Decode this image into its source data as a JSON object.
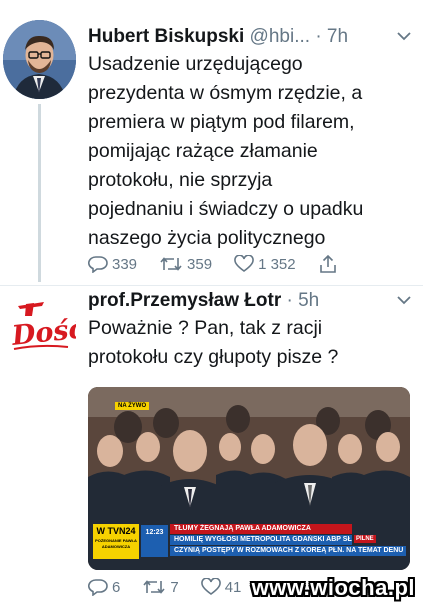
{
  "tweets": [
    {
      "author_name": "Hubert Biskupski",
      "handle": "@hbi...",
      "separator": "·",
      "time": "7h",
      "text": "Usadzenie urzędującego\nprezydenta w ósmym rzędzie, a\npremiera w piątym pod filarem,\npomijając rażące złamanie\nprotokołu, nie sprzyja\npojednaniu i świadczy o upadku\nnaszego życia politycznego",
      "actions": {
        "replies": "339",
        "retweets": "359",
        "likes": "1 352"
      },
      "icons": {
        "reply": "reply-icon",
        "retweet": "retweet-icon",
        "like": "heart-icon",
        "share": "share-icon",
        "menu": "chevron-down-icon"
      }
    },
    {
      "author_name": "prof.Przemysław Łotr",
      "handle": "",
      "separator": "·",
      "time": "5h",
      "text": "Poważnie ? Pan, tak z racji\nprotokołu czy głupoty pisze ?",
      "actions": {
        "replies": "6",
        "retweets": "7",
        "likes": "41"
      },
      "icons": {
        "reply": "reply-icon",
        "retweet": "retweet-icon",
        "like": "heart-icon",
        "menu": "chevron-down-icon"
      }
    }
  ],
  "avatar_logo_text": "Dość",
  "media": {
    "badge": "NA ŻYWO",
    "channel": "W TVN24",
    "channel_sub": "POŻEGNANIE PAWŁA ADAMOWICZA",
    "time": "12:23",
    "headline": "TŁUMY ŻEGNAJĄ PAWŁA ADAMOWICZA",
    "sub_headline": "HOMILIĘ WYGŁOSI METROPOLITA GDAŃSKI ABP SŁAWOJ LESZEK GŁÓDŹ",
    "pilne": "PILNE",
    "ticker": "CZYNIĄ POSTĘPY W ROZMOWACH Z KOREĄ PŁN. NA TEMAT DENU"
  },
  "watermark": "www.wiocha.pl",
  "colors": {
    "muted": "#657786",
    "text": "#14171a",
    "divider": "#e6ecf0",
    "news_red": "#c4151c",
    "news_blue": "#1d5fb0",
    "news_yellow": "#f6d200"
  }
}
